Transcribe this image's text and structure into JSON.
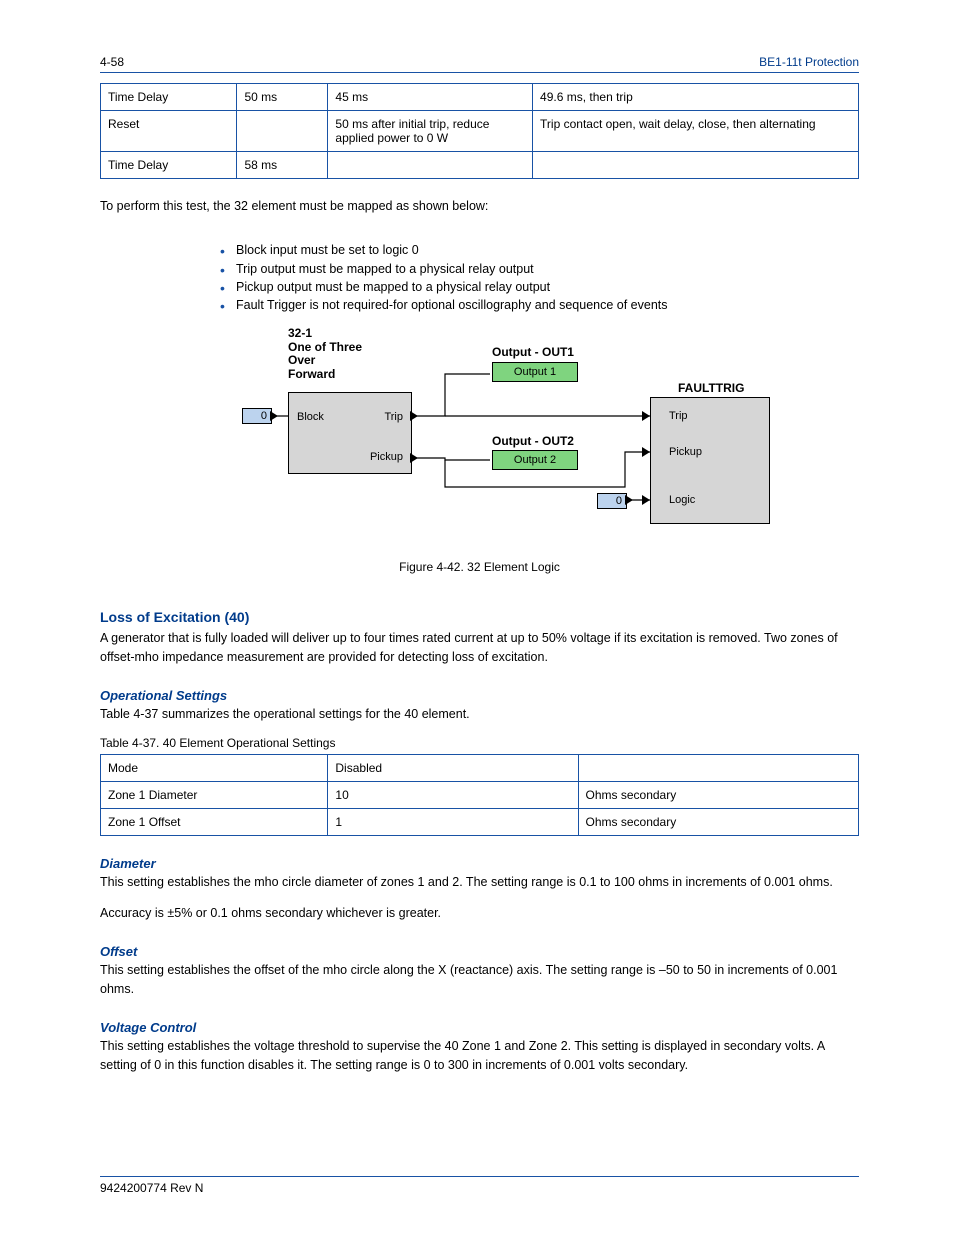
{
  "header": {
    "left": "4-58",
    "right": "BE1-11t Protection"
  },
  "table1": {
    "rows": [
      [
        "Time Delay",
        "50 ms",
        "45 ms",
        "49.6 ms, then trip"
      ],
      [
        "Reset",
        "",
        "50 ms after initial trip, reduce applied power to 0 W",
        "Trip contact open, wait delay, close, then alternating"
      ],
      [
        "Time Delay",
        "58 ms",
        "",
        ""
      ]
    ]
  },
  "bullets": {
    "intro": "To perform this test, the 32 element must be mapped as shown below:",
    "items": [
      "Block input must be set to logic 0",
      "Trip output must be mapped to a physical relay output",
      "Pickup output must be mapped to a physical relay output",
      "Fault Trigger is not required-for optional oscillography and sequence of events"
    ]
  },
  "diagram": {
    "header32": "32-1\nOne of Three\nOver\nForward",
    "out1_label": "Output - OUT1",
    "out2_label": "Output - OUT2",
    "fault_label": "FAULTTRIG",
    "zero": "0",
    "block": "Block",
    "trip": "Trip",
    "pickup": "Pickup",
    "logic": "Logic",
    "output1": "Output 1",
    "output2": "Output 2",
    "caption": "Figure 4-42. 32 Element Logic"
  },
  "section": {
    "title": "Loss of Excitation (40)",
    "intro": "A generator that is fully loaded will deliver up to four times rated current at up to 50% voltage if its excitation is removed. Two zones of offset-mho impedance measurement are provided for detecting loss of excitation."
  },
  "opsettings": {
    "title": "Operational Settings",
    "para": "Table 4-37 summarizes the operational settings for the 40 element.",
    "caption": "Table 4-37. 40 Element Operational Settings",
    "rows": [
      [
        "Mode",
        "Disabled",
        ""
      ],
      [
        "Zone 1 Diameter",
        "10",
        "Ohms secondary"
      ],
      [
        "Zone 1 Offset",
        "1",
        "Ohms secondary"
      ]
    ]
  },
  "diameter": {
    "title": "Diameter",
    "para1": "This setting establishes the mho circle diameter of zones 1 and 2. The setting range is 0.1 to 100 ohms in increments of 0.001 ohms.",
    "para2": "Accuracy is ±5% or 0.1 ohms secondary whichever is greater."
  },
  "offset": {
    "title": "Offset",
    "para": "This setting establishes the offset of the mho circle along the X (reactance) axis. The setting range is –50 to 50 in increments of 0.001 ohms."
  },
  "voltage": {
    "title": "Voltage Control",
    "para": "This setting establishes the voltage threshold to supervise the 40 Zone 1 and Zone 2. This setting is displayed in secondary volts. A setting of 0 in this function disables it. The setting range is 0 to 300 in increments of 0.001 volts secondary."
  },
  "footer": {
    "left": "9424200774 Rev N"
  }
}
